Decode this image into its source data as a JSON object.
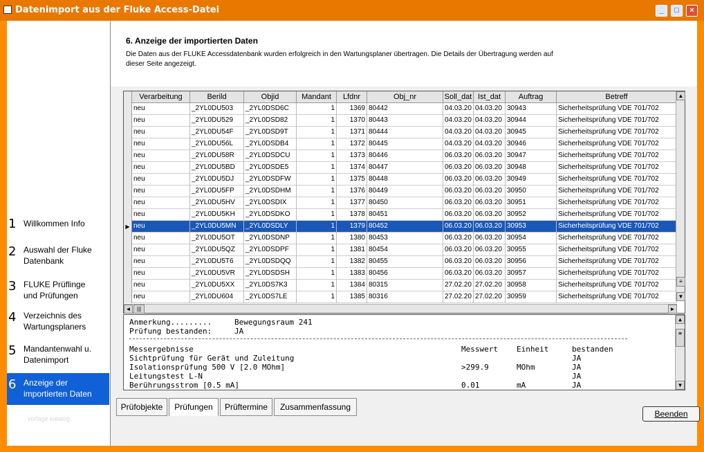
{
  "window": {
    "title": "Datenimport aus der Fluke Access-Datei"
  },
  "sidebar": {
    "items": [
      {
        "num": "1",
        "label": "Willkommen Info"
      },
      {
        "num": "2",
        "label": "Auswahl der Fluke Datenbank"
      },
      {
        "num": "3",
        "label": "FLUKE Prüflinge und Prüfungen"
      },
      {
        "num": "4",
        "label": "Verzeichnis des Wartungsplaners"
      },
      {
        "num": "5",
        "label": "Mandantenwahl u. Datenimport"
      },
      {
        "num": "6",
        "label": "Anzeige der importierten Daten"
      }
    ],
    "watermark": "vorlage katalog"
  },
  "header": {
    "title": "6. Anzeige der importierten Daten",
    "description": "Die Daten aus der FLUKE Accessdatenbank wurden erfolgreich in den Wartungsplaner übertragen. Die Details der Übertragung werden auf dieser Seite angezeigt."
  },
  "grid": {
    "columns": [
      "Verarbeitung",
      "Berild",
      "Objid",
      "Mandant",
      "Lfdnr",
      "Obj_nr",
      "Soll_dat",
      "Ist_dat",
      "Auftrag",
      "Betreff"
    ],
    "selected_index": 10,
    "rows": [
      [
        "neu",
        "_2YL0DU503",
        "_2YL0DSD6C",
        "1",
        "1369",
        "80442",
        "04.03.20",
        "04.03.20",
        "30943",
        "Sicherheitsprüfung VDE 701/702"
      ],
      [
        "neu",
        "_2YL0DU529",
        "_2YL0DSD82",
        "1",
        "1370",
        "80443",
        "04.03.20",
        "04.03.20",
        "30944",
        "Sicherheitsprüfung VDE 701/702"
      ],
      [
        "neu",
        "_2YL0DU54F",
        "_2YL0DSD9T",
        "1",
        "1371",
        "80444",
        "04.03.20",
        "04.03.20",
        "30945",
        "Sicherheitsprüfung VDE 701/702"
      ],
      [
        "neu",
        "_2YL0DU56L",
        "_2YL0DSDB4",
        "1",
        "1372",
        "80445",
        "04.03.20",
        "04.03.20",
        "30946",
        "Sicherheitsprüfung VDE 701/702"
      ],
      [
        "neu",
        "_2YL0DU58R",
        "_2YL0DSDCU",
        "1",
        "1373",
        "80446",
        "06.03.20",
        "06.03.20",
        "30947",
        "Sicherheitsprüfung VDE 701/702"
      ],
      [
        "neu",
        "_2YL0DU5BD",
        "_2YL0DSDE5",
        "1",
        "1374",
        "80447",
        "06.03.20",
        "06.03.20",
        "30948",
        "Sicherheitsprüfung VDE 701/702"
      ],
      [
        "neu",
        "_2YL0DU5DJ",
        "_2YL0DSDFW",
        "1",
        "1375",
        "80448",
        "06.03.20",
        "06.03.20",
        "30949",
        "Sicherheitsprüfung VDE 701/702"
      ],
      [
        "neu",
        "_2YL0DU5FP",
        "_2YL0DSDHM",
        "1",
        "1376",
        "80449",
        "06.03.20",
        "06.03.20",
        "30950",
        "Sicherheitsprüfung VDE 701/702"
      ],
      [
        "neu",
        "_2YL0DU5HV",
        "_2YL0DSDIX",
        "1",
        "1377",
        "80450",
        "06.03.20",
        "06.03.20",
        "30951",
        "Sicherheitsprüfung VDE 701/702"
      ],
      [
        "neu",
        "_2YL0DU5KH",
        "_2YL0DSDKO",
        "1",
        "1378",
        "80451",
        "06.03.20",
        "06.03.20",
        "30952",
        "Sicherheitsprüfung VDE 701/702"
      ],
      [
        "neu",
        "_2YL0DU5MN",
        "_2YL0DSDLY",
        "1",
        "1379",
        "80452",
        "06.03.20",
        "06.03.20",
        "30953",
        "Sicherheitsprüfung VDE 701/702"
      ],
      [
        "neu",
        "_2YL0DU5OT",
        "_2YL0DSDNP",
        "1",
        "1380",
        "80453",
        "06.03.20",
        "06.03.20",
        "30954",
        "Sicherheitsprüfung VDE 701/702"
      ],
      [
        "neu",
        "_2YL0DU5QZ",
        "_2YL0DSDPF",
        "1",
        "1381",
        "80454",
        "06.03.20",
        "06.03.20",
        "30955",
        "Sicherheitsprüfung VDE 701/702"
      ],
      [
        "neu",
        "_2YL0DU5T6",
        "_2YL0DSDQQ",
        "1",
        "1382",
        "80455",
        "06.03.20",
        "06.03.20",
        "30956",
        "Sicherheitsprüfung VDE 701/702"
      ],
      [
        "neu",
        "_2YL0DU5VR",
        "_2YL0DSDSH",
        "1",
        "1383",
        "80456",
        "06.03.20",
        "06.03.20",
        "30957",
        "Sicherheitsprüfung VDE 701/702"
      ],
      [
        "neu",
        "_2YL0DU5XX",
        "_2YL0DS7K3",
        "1",
        "1384",
        "80315",
        "27.02.20",
        "27.02.20",
        "30958",
        "Sicherheitsprüfung VDE 701/702"
      ],
      [
        "neu",
        "_2YL0DU604",
        "_2YL0DS7LE",
        "1",
        "1385",
        "80316",
        "27.02.20",
        "27.02.20",
        "30959",
        "Sicherheitsprüfung VDE 701/702"
      ]
    ]
  },
  "detail": {
    "anmerkung_label": "Anmerkung.........",
    "anmerkung_value": "Bewegungsraum 241",
    "pruefung_label": "Prüfung bestanden:",
    "pruefung_value": "JA",
    "headers": [
      "Messergebnisse",
      "Messwert",
      "Einheit",
      "bestanden"
    ],
    "rows": [
      [
        "Sichtprüfung für Gerät und Zuleitung",
        "",
        "",
        "JA"
      ],
      [
        "Isolationsprüfung 500 V [2.0 MOhm]",
        ">299.9",
        "MOhm",
        "JA"
      ],
      [
        "Leitungstest L-N",
        "",
        "",
        "JA"
      ],
      [
        "Berührungsstrom [0.5 mA]",
        "0.01",
        "mA",
        "JA"
      ]
    ]
  },
  "tabs": [
    "Prüfobjekte",
    "Prüfungen",
    "Prüftermine",
    "Zusammenfassung"
  ],
  "active_tab": "Prüfungen",
  "buttons": {
    "beenden": "Beenden"
  }
}
